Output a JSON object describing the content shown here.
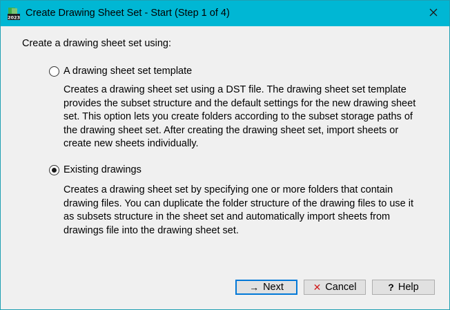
{
  "window": {
    "title": "Create Drawing Sheet Set - Start (Step 1 of 4)",
    "app_icon_badge": "2023",
    "accent": "#00b7d4"
  },
  "main": {
    "intro": "Create a drawing sheet set using:",
    "options": [
      {
        "label": "A drawing sheet set template",
        "selected": false,
        "description": "Creates a drawing sheet set using a DST file. The drawing sheet set template provides the subset structure and the default settings for the new drawing sheet set. This option lets you create folders according to the subset storage paths of the drawing sheet set. After creating the drawing sheet set, import sheets or create new sheets individually."
      },
      {
        "label": "Existing drawings",
        "selected": true,
        "description": "Creates a drawing sheet set by specifying one or more folders that contain drawing files. You can duplicate the folder structure of the drawing files to use it as subsets structure in the sheet set and automatically import sheets from drawings file into the drawing sheet set."
      }
    ]
  },
  "buttons": {
    "next": {
      "label": "Next",
      "icon": "→"
    },
    "cancel": {
      "label": "Cancel",
      "icon": "✕"
    },
    "help": {
      "label": "Help",
      "icon": "?"
    }
  }
}
